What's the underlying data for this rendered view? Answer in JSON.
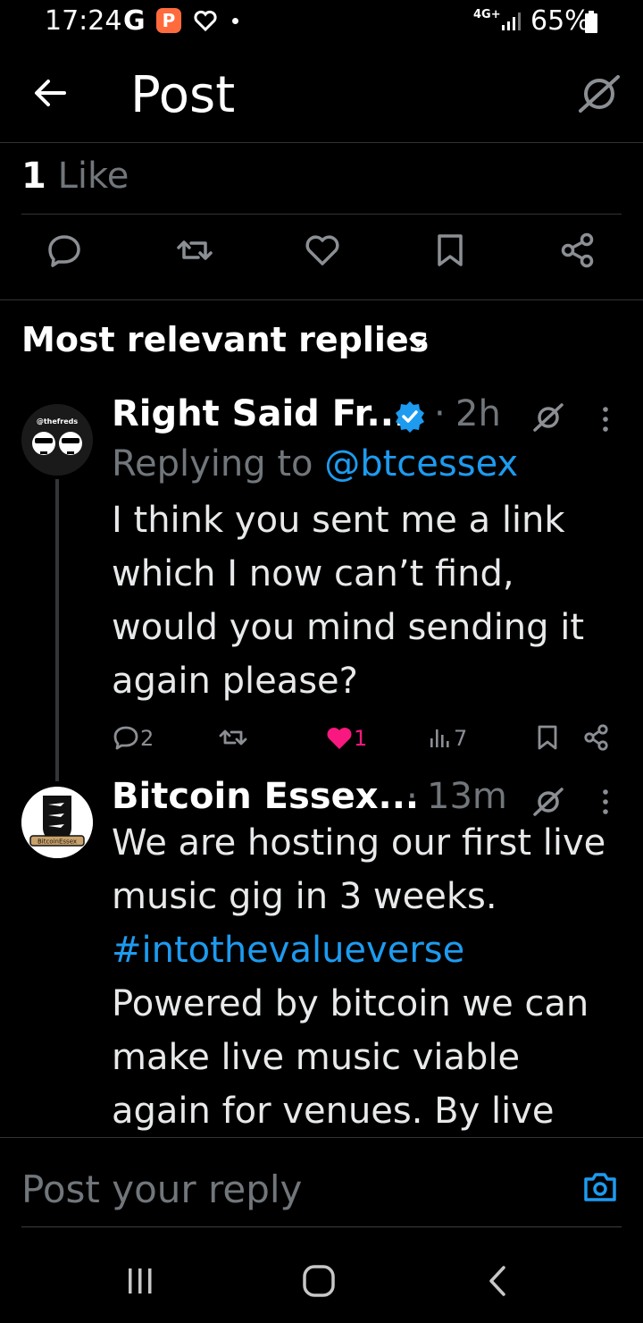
{
  "status_bar": {
    "time": "17:24",
    "carrier_g": "G",
    "app_badge": "P",
    "network": "4G+",
    "battery_percent": "65%"
  },
  "header": {
    "title": "Post",
    "back_icon": "arrow-left-icon",
    "grok_icon": "grok-icon"
  },
  "likes": {
    "count": "1",
    "label": "Like"
  },
  "actions": [
    "reply-icon",
    "repost-icon",
    "like-icon",
    "bookmark-icon",
    "share-icon"
  ],
  "replies_section": {
    "title": "Most relevant replies"
  },
  "replies": [
    {
      "name": "Right Said Fr...",
      "verified": true,
      "separator": "·",
      "time": "2h",
      "replying_prefix": "Replying to",
      "replying_handle": "@btcessex",
      "avatar_label": "@thefreds",
      "lines": [
        "I think you sent me a link",
        "which I now can’t find,",
        "would you mind sending it",
        "again please?"
      ],
      "stats": {
        "replies": "2",
        "likes": "1",
        "views": "7"
      },
      "like_color": "#f91880"
    },
    {
      "name": "Bitcoin Essex...",
      "separator": "·",
      "time": "13m",
      "avatar_label": "BitcoinEssex",
      "lines": [
        "We are hosting our first live",
        "music gig in 3 weeks."
      ],
      "hashtag": "#intothevalueverse",
      "more_lines": [
        "Powered by bitcoin we can",
        "make live music viable",
        "again for venues. By live"
      ]
    }
  ],
  "composer": {
    "placeholder": "Post your reply",
    "camera_icon": "camera-icon"
  },
  "nav": [
    "recent-apps-icon",
    "home-icon",
    "back-nav-icon"
  ],
  "colors": {
    "accent": "#1d9bf0",
    "like": "#f91880",
    "muted": "#71767b",
    "background": "#000000"
  }
}
